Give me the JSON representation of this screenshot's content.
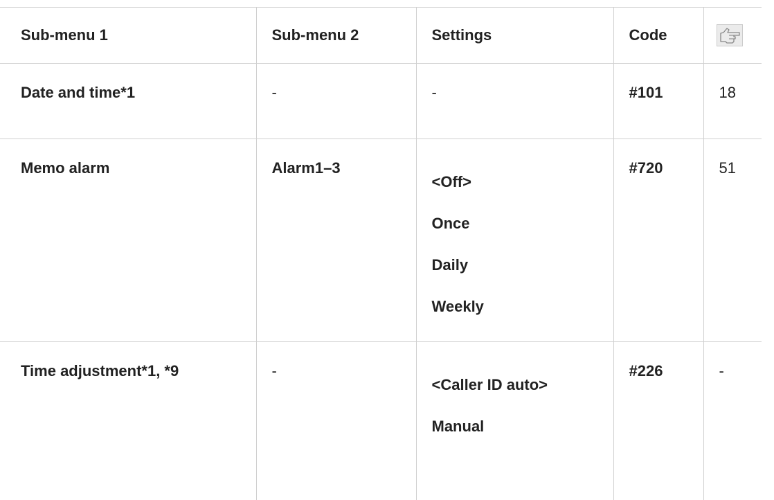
{
  "table": {
    "headers": {
      "sub_menu_1": "Sub-menu 1",
      "sub_menu_2": "Sub-menu 2",
      "settings": "Settings",
      "code": "Code",
      "page_ref_icon": "pointing-hand-icon"
    },
    "rows": [
      {
        "sub_menu_1": "Date and time*1",
        "sub_menu_2": "-",
        "settings": [
          "-"
        ],
        "code": "#101",
        "page": "18"
      },
      {
        "sub_menu_1": "Memo alarm",
        "sub_menu_2": "Alarm1–3",
        "settings": [
          "<Off>",
          "Once",
          "Daily",
          "Weekly"
        ],
        "code": "#720",
        "page": "51"
      },
      {
        "sub_menu_1": "Time adjustment*1, *9",
        "sub_menu_2": "-",
        "settings": [
          "<Caller ID auto>",
          "Manual"
        ],
        "code": "#226",
        "page": "-"
      }
    ]
  },
  "colors": {
    "border": "#d0d0d0",
    "text": "#222222",
    "icon_bg": "#ebebeb"
  }
}
